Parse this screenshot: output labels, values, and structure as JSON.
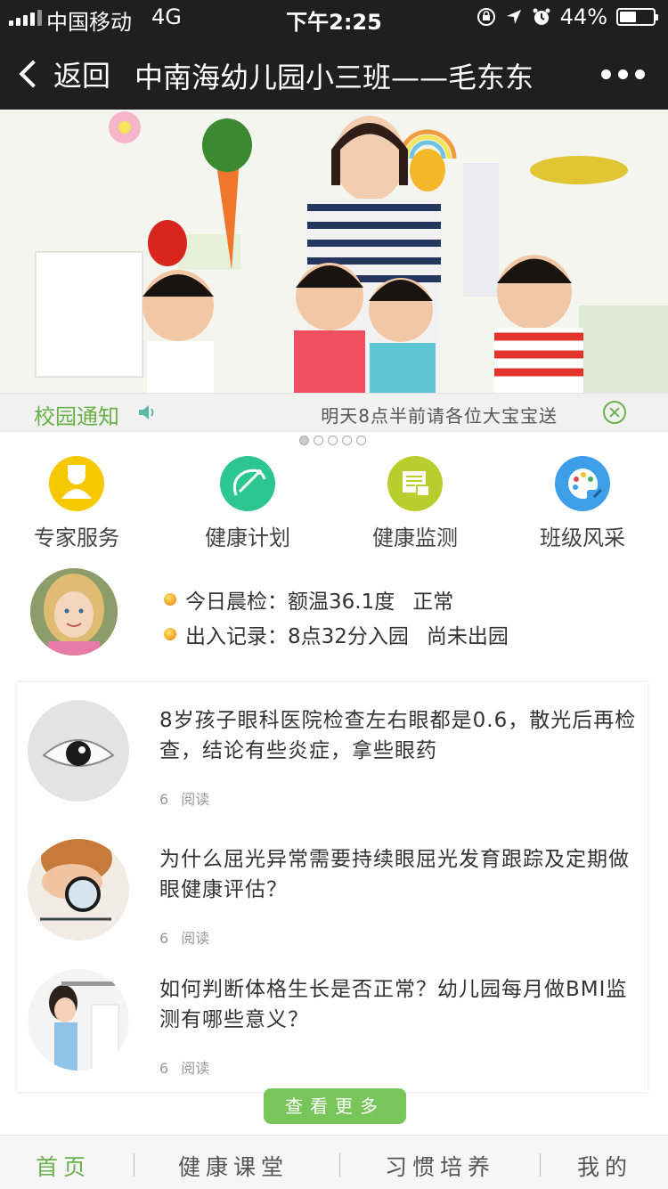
{
  "status_bar": {
    "carrier": "中国移动",
    "network": "4G",
    "time": "下午2:25",
    "battery": "44%"
  },
  "nav": {
    "back_label": "返回",
    "title": "中南海幼儿园小三班——毛东东"
  },
  "notice": {
    "label": "校园通知",
    "text": "明天8点半前请各位大宝宝送"
  },
  "banner": {
    "active_index": 0,
    "count": 5
  },
  "features": [
    {
      "label": "专家服务",
      "icon": "expert-icon",
      "color": "#f5c800"
    },
    {
      "label": "健康计划",
      "icon": "compass-icon",
      "color": "#2cc78f"
    },
    {
      "label": "健康监测",
      "icon": "monitor-icon",
      "color": "#b7cf2e"
    },
    {
      "label": "班级风采",
      "icon": "palette-icon",
      "color": "#3d9fe8"
    }
  ],
  "child": {
    "check_label": "今日晨检：",
    "check_value": "额温36.1度",
    "check_status": "正常",
    "record_label": "出入记录：",
    "record_value": "8点32分入园",
    "record_status": "尚未出园"
  },
  "articles": [
    {
      "title": "8岁孩子眼科医院检查左右眼都是0.6，散光后再检查，结论有些炎症，拿些眼药",
      "count": "6",
      "reads_label": "阅读"
    },
    {
      "title": "为什么屈光异常需要持续眼屈光发育跟踪及定期做眼健康评估？",
      "count": "6",
      "reads_label": "阅读"
    },
    {
      "title": "如何判断体格生长是否正常？幼儿园每月做BMI监测有哪些意义？",
      "count": "6",
      "reads_label": "阅读"
    }
  ],
  "more_button": "查看更多",
  "tabs": [
    "首页",
    "健康课堂",
    "习惯培养",
    "我的"
  ],
  "colors": {
    "accent": "#6ab04c",
    "button": "#78c55a",
    "header": "#1f1f1f"
  }
}
